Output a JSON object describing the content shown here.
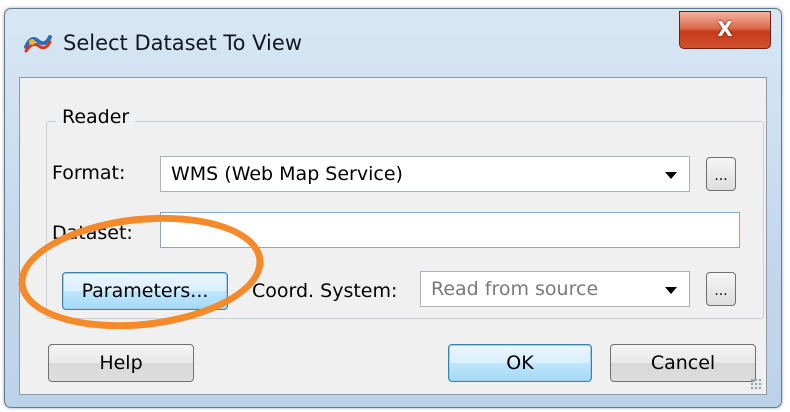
{
  "window": {
    "title": "Select Dataset To View",
    "close_label": "X"
  },
  "reader": {
    "group_label": "Reader",
    "format": {
      "label": "Format:",
      "value": "WMS (Web Map Service)",
      "browse_label": "..."
    },
    "dataset": {
      "label": "Dataset:",
      "value": ""
    },
    "parameters_label": "Parameters...",
    "coord_system": {
      "label": "Coord. System:",
      "value": "Read from source",
      "browse_label": "..."
    }
  },
  "buttons": {
    "help": "Help",
    "ok": "OK",
    "cancel": "Cancel"
  },
  "colors": {
    "annotation": "#f58a2a",
    "title_bar": "#c4d8ec",
    "close_button": "#c53a18",
    "ok_focus": "#3c7fb1"
  },
  "icons": {
    "app": "app-logo-icon",
    "close": "close-icon",
    "dropdown": "chevron-down-icon"
  }
}
